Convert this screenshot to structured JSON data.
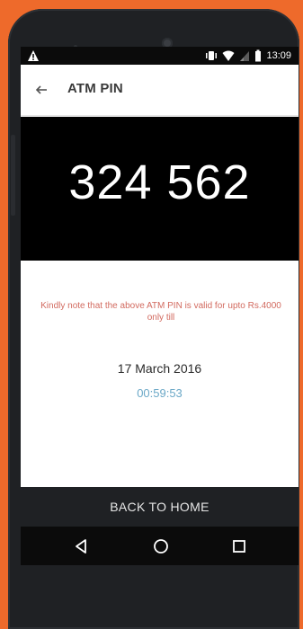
{
  "status_bar": {
    "time": "13:09",
    "icons": [
      "warning-icon",
      "vibrate-icon",
      "wifi-icon",
      "signal-icon",
      "battery-icon"
    ]
  },
  "app_bar": {
    "title": "ATM PIN",
    "back_icon": "back-arrow-icon"
  },
  "pin": {
    "value": "324 562"
  },
  "notice": {
    "text": "Kindly note that the above ATM PIN is valid for upto Rs.4000 only till"
  },
  "validity": {
    "date": "17 March 2016",
    "countdown": "00:59:53"
  },
  "actions": {
    "back_home_label": "BACK TO HOME"
  },
  "nav": {
    "icons": [
      "back-triangle-icon",
      "home-circle-icon",
      "recents-square-icon"
    ]
  },
  "colors": {
    "background": "#ee6a2b",
    "notice": "#d26a5f",
    "countdown": "#6ba8c7",
    "pin_panel": "#000000",
    "action_bar": "#1f2124"
  }
}
